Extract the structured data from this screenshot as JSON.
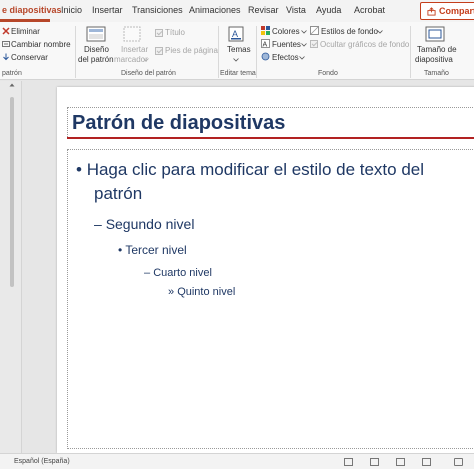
{
  "tabs": [
    {
      "label": "e diapositivas",
      "active": true
    },
    {
      "label": "Inicio"
    },
    {
      "label": "Insertar"
    },
    {
      "label": "Transiciones"
    },
    {
      "label": "Animaciones"
    },
    {
      "label": "Revisar"
    },
    {
      "label": "Vista"
    },
    {
      "label": "Ayuda"
    },
    {
      "label": "Acrobat"
    }
  ],
  "share_label": "Compartir",
  "ribbon": {
    "edit_group": {
      "eliminar": "Eliminar",
      "cambiar_nombre": "Cambiar nombre",
      "conservar": "Conservar",
      "label": "patrón"
    },
    "layout_group": {
      "diseno_line1": "Diseño",
      "diseno_line2": "del patrón",
      "insertar_line1": "Insertar",
      "insertar_line2": "marcador",
      "titulo": "Título",
      "pies": "Pies de página",
      "label": "Diseño del patrón"
    },
    "theme_group": {
      "temas": "Temas",
      "label": "Editar tema"
    },
    "background_group": {
      "colores": "Colores",
      "fuentes": "Fuentes",
      "efectos": "Efectos",
      "estilos": "Estilos de fondo",
      "ocultar": "Ocultar gráficos de fondo",
      "label": "Fondo"
    },
    "size_group": {
      "tamano_line1": "Tamaño de",
      "tamano_line2": "diapositiva",
      "label": "Tamaño"
    }
  },
  "slide": {
    "title": "Patrón de diapositivas",
    "level1_line1": "Haga clic para modificar el estilo de texto del",
    "level1_line2": "patrón",
    "level2": "Segundo nivel",
    "level3": "Tercer nivel",
    "level4": "Cuarto nivel",
    "level5": "Quinto nivel",
    "bullets": {
      "l1": "•",
      "l2": "–",
      "l3": "•",
      "l4": "–",
      "l5": "»"
    }
  },
  "status": {
    "language": "Español (España)"
  },
  "colors": {
    "accent": "#b7472a",
    "title": "#1f3864",
    "title_rule": "#b22222"
  }
}
